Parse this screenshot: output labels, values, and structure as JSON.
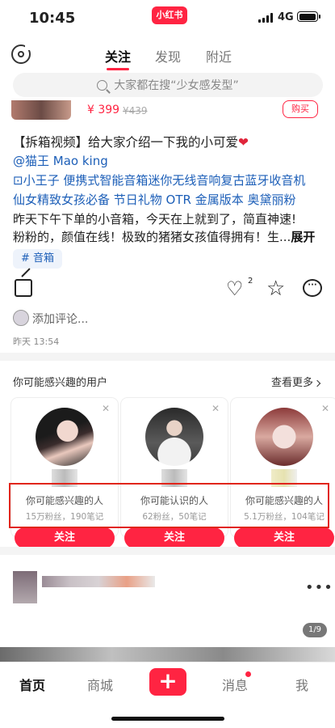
{
  "status_bar": {
    "time": "10:45",
    "network": "4G",
    "app_logo": "小红书",
    "battery_level": 0.85
  },
  "nav": {
    "tabs": [
      "关注",
      "发现",
      "附近"
    ],
    "active_tab": 0,
    "camera_icon": "camera-icon"
  },
  "search": {
    "placeholder": "大家都在搜“少女感发型”"
  },
  "product": {
    "price": "¥ 399",
    "original_price": "¥439",
    "buy_label": "购买"
  },
  "post": {
    "title": "【拆箱视频】给大家介绍一下我的小可爱",
    "author_mention": "@猫王 Mao king",
    "product_line_1": "小王子 便携式智能音箱迷你无线音响复古蓝牙收音机",
    "product_line_2": "仙女精致女孩必备 节日礼物 OTR 金属版本 奥黛丽粉",
    "body_line_1": "昨天下午下单的小音箱，今天在上就到了，简直神速!",
    "body_line_2": "粉粉的，颜值在线！极致的猪猪女孩值得拥有！生...",
    "expand_label": "展开",
    "tag": "音箱",
    "like_count": "2",
    "comment_placeholder": "添加评论...",
    "timestamp": "昨天 13:54"
  },
  "suggested": {
    "heading": "你可能感兴趣的用户",
    "see_more": "查看更多",
    "cards": [
      {
        "reason": "你可能感兴趣的人",
        "stats": "15万粉丝，190笔记",
        "follow": "关注"
      },
      {
        "reason": "你可能认识的人",
        "stats": "62粉丝，50笔记",
        "follow": "关注"
      },
      {
        "reason": "你可能感兴趣的人",
        "stats": "5.1万粉丝，104笔记",
        "follow": "关注"
      }
    ]
  },
  "next_post": {
    "page_indicator": "1/9"
  },
  "bottom_nav": {
    "tabs": [
      "首页",
      "商城",
      "消息",
      "我"
    ],
    "active_tab": 0,
    "plus": "+"
  },
  "colors": {
    "accent": "#ff2442",
    "link": "#1d5fb8",
    "highlight_box": "#e1251b"
  }
}
